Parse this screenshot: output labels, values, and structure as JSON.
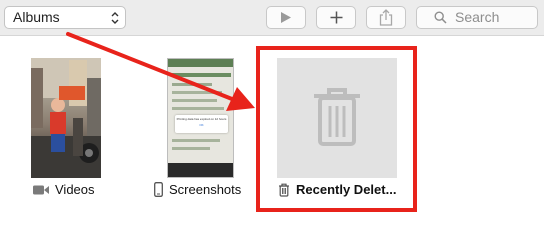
{
  "toolbar": {
    "albums_selector": {
      "value": "Albums"
    },
    "search": {
      "placeholder": "Search"
    },
    "buttons": {
      "play": {
        "icon": "play-icon"
      },
      "add": {
        "icon": "plus-icon"
      },
      "share": {
        "icon": "share-icon"
      }
    }
  },
  "albums": [
    {
      "label": "Videos",
      "icon": "video-camera-icon"
    },
    {
      "label": "Screenshots",
      "icon": "phone-icon"
    },
    {
      "label": "Recently Delet...",
      "icon": "trash-icon"
    }
  ],
  "screenshot_thumbnail": {
    "dialog_text": "Printing data has expired on 12 hours",
    "dialog_button": "OK"
  },
  "annotation": {
    "color": "#e8231b"
  }
}
